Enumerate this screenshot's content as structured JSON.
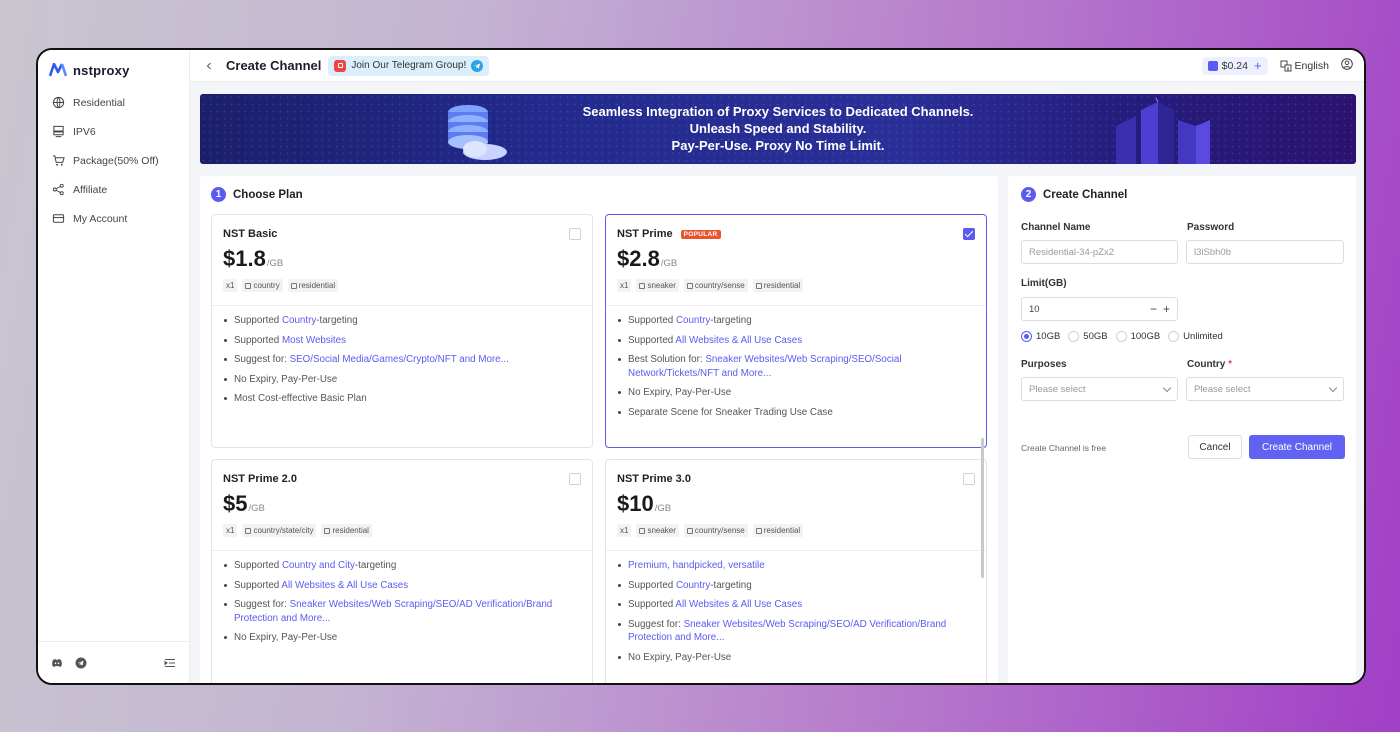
{
  "app": {
    "logo_text": "nstproxy"
  },
  "sidebar": {
    "items": [
      {
        "label": "Residential",
        "icon": "globe-icon"
      },
      {
        "label": "IPV6",
        "icon": "server-icon"
      },
      {
        "label": "Package(50% Off)",
        "icon": "cart-icon"
      },
      {
        "label": "Affiliate",
        "icon": "share-icon"
      },
      {
        "label": "My Account",
        "icon": "card-icon"
      }
    ],
    "footer_icons": [
      "discord-icon",
      "telegram-icon",
      "collapse-icon"
    ]
  },
  "topbar": {
    "title": "Create Channel",
    "telegram_banner": "Join Our Telegram Group!",
    "balance": "$0.24",
    "language": "English"
  },
  "hero": {
    "line1": "Seamless Integration of Proxy Services to Dedicated Channels.",
    "line2": "Unleash Speed and Stability.",
    "line3": "Pay-Per-Use. Proxy No Time Limit."
  },
  "plans_section": {
    "step": "1",
    "title": "Choose Plan",
    "plans": [
      {
        "name": "NST Basic",
        "price": "$1.8",
        "unit": "/GB",
        "badge": "",
        "selected": false,
        "tags": [
          "x1",
          "country",
          "residential"
        ],
        "features": [
          [
            "Supported ",
            "Country",
            "-targeting"
          ],
          [
            "Supported ",
            "Most Websites",
            ""
          ],
          [
            "Suggest for: ",
            "SEO/Social Media/Games/Crypto/NFT and More...",
            ""
          ],
          [
            "No Expiry, Pay-Per-Use",
            "",
            ""
          ],
          [
            "Most Cost-effective Basic Plan",
            "",
            ""
          ]
        ]
      },
      {
        "name": "NST Prime",
        "price": "$2.8",
        "unit": "/GB",
        "badge": "POPULAR",
        "selected": true,
        "tags": [
          "x1",
          "sneaker",
          "country/sense",
          "residential"
        ],
        "features": [
          [
            "Supported ",
            "Country",
            "-targeting"
          ],
          [
            "Supported ",
            "All Websites & All Use Cases",
            ""
          ],
          [
            "Best Solution for: ",
            "Sneaker Websites/Web Scraping/SEO/Social Network/Tickets/NFT and More...",
            ""
          ],
          [
            "No Expiry, Pay-Per-Use",
            "",
            ""
          ],
          [
            "Separate Scene for Sneaker Trading Use Case",
            "",
            ""
          ]
        ]
      },
      {
        "name": "NST Prime 2.0",
        "price": "$5",
        "unit": "/GB",
        "badge": "",
        "selected": false,
        "tags": [
          "x1",
          "country/state/city",
          "residential"
        ],
        "features": [
          [
            "Supported ",
            "Country and City",
            "-targeting"
          ],
          [
            "Supported ",
            "All Websites & All Use Cases",
            ""
          ],
          [
            "Suggest for: ",
            "Sneaker Websites/Web Scraping/SEO/AD Verification/Brand Protection and More...",
            ""
          ],
          [
            "No Expiry, Pay-Per-Use",
            "",
            ""
          ]
        ]
      },
      {
        "name": "NST Prime 3.0",
        "price": "$10",
        "unit": "/GB",
        "badge": "",
        "selected": false,
        "tags": [
          "x1",
          "sneaker",
          "country/sense",
          "residential"
        ],
        "features": [
          [
            "",
            "Premium, handpicked, versatile",
            ""
          ],
          [
            "Supported ",
            "Country",
            "-targeting"
          ],
          [
            "Supported ",
            "All Websites & All Use Cases",
            ""
          ],
          [
            "Suggest for: ",
            "Sneaker Websites/Web Scraping/SEO/AD Verification/Brand Protection and More...",
            ""
          ],
          [
            "No Expiry, Pay-Per-Use",
            "",
            ""
          ]
        ]
      }
    ]
  },
  "create_section": {
    "step": "2",
    "title": "Create Channel",
    "channel_name_label": "Channel Name",
    "channel_name_placeholder": "Residential-34-pZx2",
    "password_label": "Password",
    "password_placeholder": "l3iSbh0b",
    "limit_label": "Limit(GB)",
    "limit_value": "10",
    "limit_options": [
      {
        "label": "10GB",
        "selected": true
      },
      {
        "label": "50GB",
        "selected": false
      },
      {
        "label": "100GB",
        "selected": false
      },
      {
        "label": "Unlimited",
        "selected": false
      }
    ],
    "purposes_label": "Purposes",
    "purposes_placeholder": "Please select",
    "country_label": "Country",
    "country_required": "*",
    "country_placeholder": "Please select",
    "free_note": "Create Channel is free",
    "cancel_label": "Cancel",
    "create_label": "Create Channel"
  },
  "colors": {
    "accent": "#5b5bf0",
    "popular": "#e8552e",
    "chat": "#1b8de6"
  }
}
